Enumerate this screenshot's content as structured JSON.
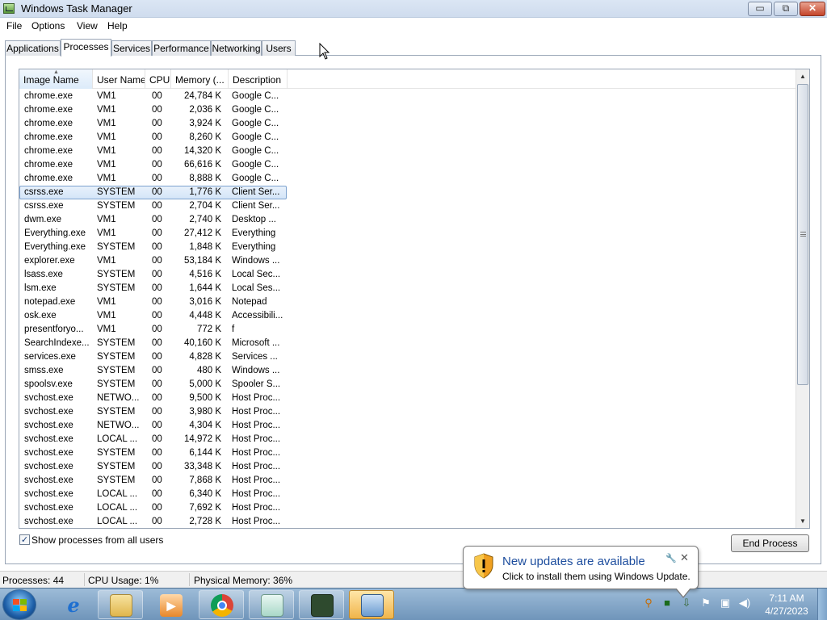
{
  "window": {
    "title": "Windows Task Manager",
    "min": "▭",
    "max": "⧉",
    "close": "✕"
  },
  "menu": [
    "File",
    "Options",
    "View",
    "Help"
  ],
  "tabs": [
    "Applications",
    "Processes",
    "Services",
    "Performance",
    "Networking",
    "Users"
  ],
  "active_tab": "Processes",
  "columns": [
    "Image Name",
    "User Name",
    "CPU",
    "Memory (...",
    "Description"
  ],
  "processes": [
    {
      "name": "chrome.exe",
      "user": "VM1",
      "cpu": "00",
      "mem": "24,784 K",
      "desc": "Google C..."
    },
    {
      "name": "chrome.exe",
      "user": "VM1",
      "cpu": "00",
      "mem": "2,036 K",
      "desc": "Google C..."
    },
    {
      "name": "chrome.exe",
      "user": "VM1",
      "cpu": "00",
      "mem": "3,924 K",
      "desc": "Google C..."
    },
    {
      "name": "chrome.exe",
      "user": "VM1",
      "cpu": "00",
      "mem": "8,260 K",
      "desc": "Google C..."
    },
    {
      "name": "chrome.exe",
      "user": "VM1",
      "cpu": "00",
      "mem": "14,320 K",
      "desc": "Google C..."
    },
    {
      "name": "chrome.exe",
      "user": "VM1",
      "cpu": "00",
      "mem": "66,616 K",
      "desc": "Google C..."
    },
    {
      "name": "chrome.exe",
      "user": "VM1",
      "cpu": "00",
      "mem": "8,888 K",
      "desc": "Google C..."
    },
    {
      "name": "csrss.exe",
      "user": "SYSTEM",
      "cpu": "00",
      "mem": "1,776 K",
      "desc": "Client Ser...",
      "selected": true
    },
    {
      "name": "csrss.exe",
      "user": "SYSTEM",
      "cpu": "00",
      "mem": "2,704 K",
      "desc": "Client Ser..."
    },
    {
      "name": "dwm.exe",
      "user": "VM1",
      "cpu": "00",
      "mem": "2,740 K",
      "desc": "Desktop ..."
    },
    {
      "name": "Everything.exe",
      "user": "VM1",
      "cpu": "00",
      "mem": "27,412 K",
      "desc": "Everything"
    },
    {
      "name": "Everything.exe",
      "user": "SYSTEM",
      "cpu": "00",
      "mem": "1,848 K",
      "desc": "Everything"
    },
    {
      "name": "explorer.exe",
      "user": "VM1",
      "cpu": "00",
      "mem": "53,184 K",
      "desc": "Windows ..."
    },
    {
      "name": "lsass.exe",
      "user": "SYSTEM",
      "cpu": "00",
      "mem": "4,516 K",
      "desc": "Local Sec..."
    },
    {
      "name": "lsm.exe",
      "user": "SYSTEM",
      "cpu": "00",
      "mem": "1,644 K",
      "desc": "Local Ses..."
    },
    {
      "name": "notepad.exe",
      "user": "VM1",
      "cpu": "00",
      "mem": "3,016 K",
      "desc": "Notepad"
    },
    {
      "name": "osk.exe",
      "user": "VM1",
      "cpu": "00",
      "mem": "4,448 K",
      "desc": "Accessibili..."
    },
    {
      "name": "presentforyo...",
      "user": "VM1",
      "cpu": "00",
      "mem": "772 K",
      "desc": "f"
    },
    {
      "name": "SearchIndexe...",
      "user": "SYSTEM",
      "cpu": "00",
      "mem": "40,160 K",
      "desc": "Microsoft ..."
    },
    {
      "name": "services.exe",
      "user": "SYSTEM",
      "cpu": "00",
      "mem": "4,828 K",
      "desc": "Services ..."
    },
    {
      "name": "smss.exe",
      "user": "SYSTEM",
      "cpu": "00",
      "mem": "480 K",
      "desc": "Windows ..."
    },
    {
      "name": "spoolsv.exe",
      "user": "SYSTEM",
      "cpu": "00",
      "mem": "5,000 K",
      "desc": "Spooler S..."
    },
    {
      "name": "svchost.exe",
      "user": "NETWO...",
      "cpu": "00",
      "mem": "9,500 K",
      "desc": "Host Proc..."
    },
    {
      "name": "svchost.exe",
      "user": "SYSTEM",
      "cpu": "00",
      "mem": "3,980 K",
      "desc": "Host Proc..."
    },
    {
      "name": "svchost.exe",
      "user": "NETWO...",
      "cpu": "00",
      "mem": "4,304 K",
      "desc": "Host Proc..."
    },
    {
      "name": "svchost.exe",
      "user": "LOCAL ...",
      "cpu": "00",
      "mem": "14,972 K",
      "desc": "Host Proc..."
    },
    {
      "name": "svchost.exe",
      "user": "SYSTEM",
      "cpu": "00",
      "mem": "6,144 K",
      "desc": "Host Proc..."
    },
    {
      "name": "svchost.exe",
      "user": "SYSTEM",
      "cpu": "00",
      "mem": "33,348 K",
      "desc": "Host Proc..."
    },
    {
      "name": "svchost.exe",
      "user": "SYSTEM",
      "cpu": "00",
      "mem": "7,868 K",
      "desc": "Host Proc..."
    },
    {
      "name": "svchost.exe",
      "user": "LOCAL ...",
      "cpu": "00",
      "mem": "6,340 K",
      "desc": "Host Proc..."
    },
    {
      "name": "svchost.exe",
      "user": "LOCAL ...",
      "cpu": "00",
      "mem": "7,692 K",
      "desc": "Host Proc..."
    },
    {
      "name": "svchost.exe",
      "user": "LOCAL ...",
      "cpu": "00",
      "mem": "2,728 K",
      "desc": "Host Proc..."
    }
  ],
  "show_all_label": "Show processes from all users",
  "show_all_checked": true,
  "end_process_label": "End Process",
  "status": {
    "processes": "Processes: 44",
    "cpu": "CPU Usage: 1%",
    "memory": "Physical Memory: 36%"
  },
  "notification": {
    "title": "New updates are available",
    "text": "Click to install them using Windows Update."
  },
  "clock": {
    "time": "7:11 AM",
    "date": "4/27/2023"
  },
  "taskbar_apps": [
    "internet-explorer",
    "windows-explorer",
    "media-player",
    "chrome",
    "notepad",
    "remote-desktop",
    "task-manager"
  ],
  "colors": {
    "selection": "#d4e5f8",
    "balloon_title": "#1e4e9e",
    "taskbar": "#6f95ba"
  }
}
